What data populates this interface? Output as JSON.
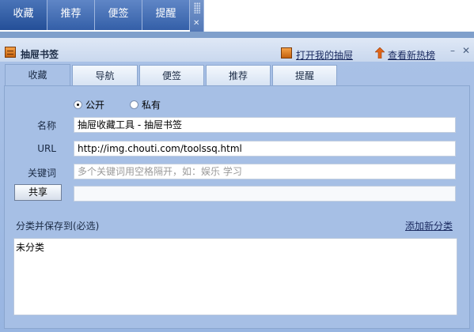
{
  "top_tabs": [
    {
      "label": "收藏",
      "active": true
    },
    {
      "label": "推荐",
      "active": false
    },
    {
      "label": "便签",
      "active": false
    },
    {
      "label": "提醒",
      "active": false
    }
  ],
  "panel": {
    "title": "抽屉书签",
    "open_drawer_link": "打开我的抽屉",
    "hot_list_link": "查看新热榜",
    "minimize_icon": "minimize-icon",
    "close_icon": "close-icon"
  },
  "inner_tabs": [
    {
      "label": "收藏",
      "active": true
    },
    {
      "label": "导航",
      "active": false
    },
    {
      "label": "便签",
      "active": false
    },
    {
      "label": "推荐",
      "active": false
    },
    {
      "label": "提醒",
      "active": false
    }
  ],
  "form": {
    "visibility": {
      "public_label": "公开",
      "private_label": "私有",
      "selected": "公开"
    },
    "name_label": "名称",
    "name_value": "抽屉收藏工具 - 抽屉书签",
    "url_label": "URL",
    "url_value": "http://img.chouti.com/toolssq.html",
    "keywords_label": "关键词",
    "keywords_placeholder": "多个关键词用空格隔开，如：娱乐 学习",
    "share_button": "共享",
    "share_value": "",
    "category_label": "分类并保存到(必选)",
    "add_category_link": "添加新分类",
    "categories": [
      "未分类"
    ]
  },
  "colors": {
    "accent": "#345fa8",
    "panel": "#a6bfe5",
    "drawer_icon": "#e07a20",
    "arrow_icon": "#e0661a"
  }
}
